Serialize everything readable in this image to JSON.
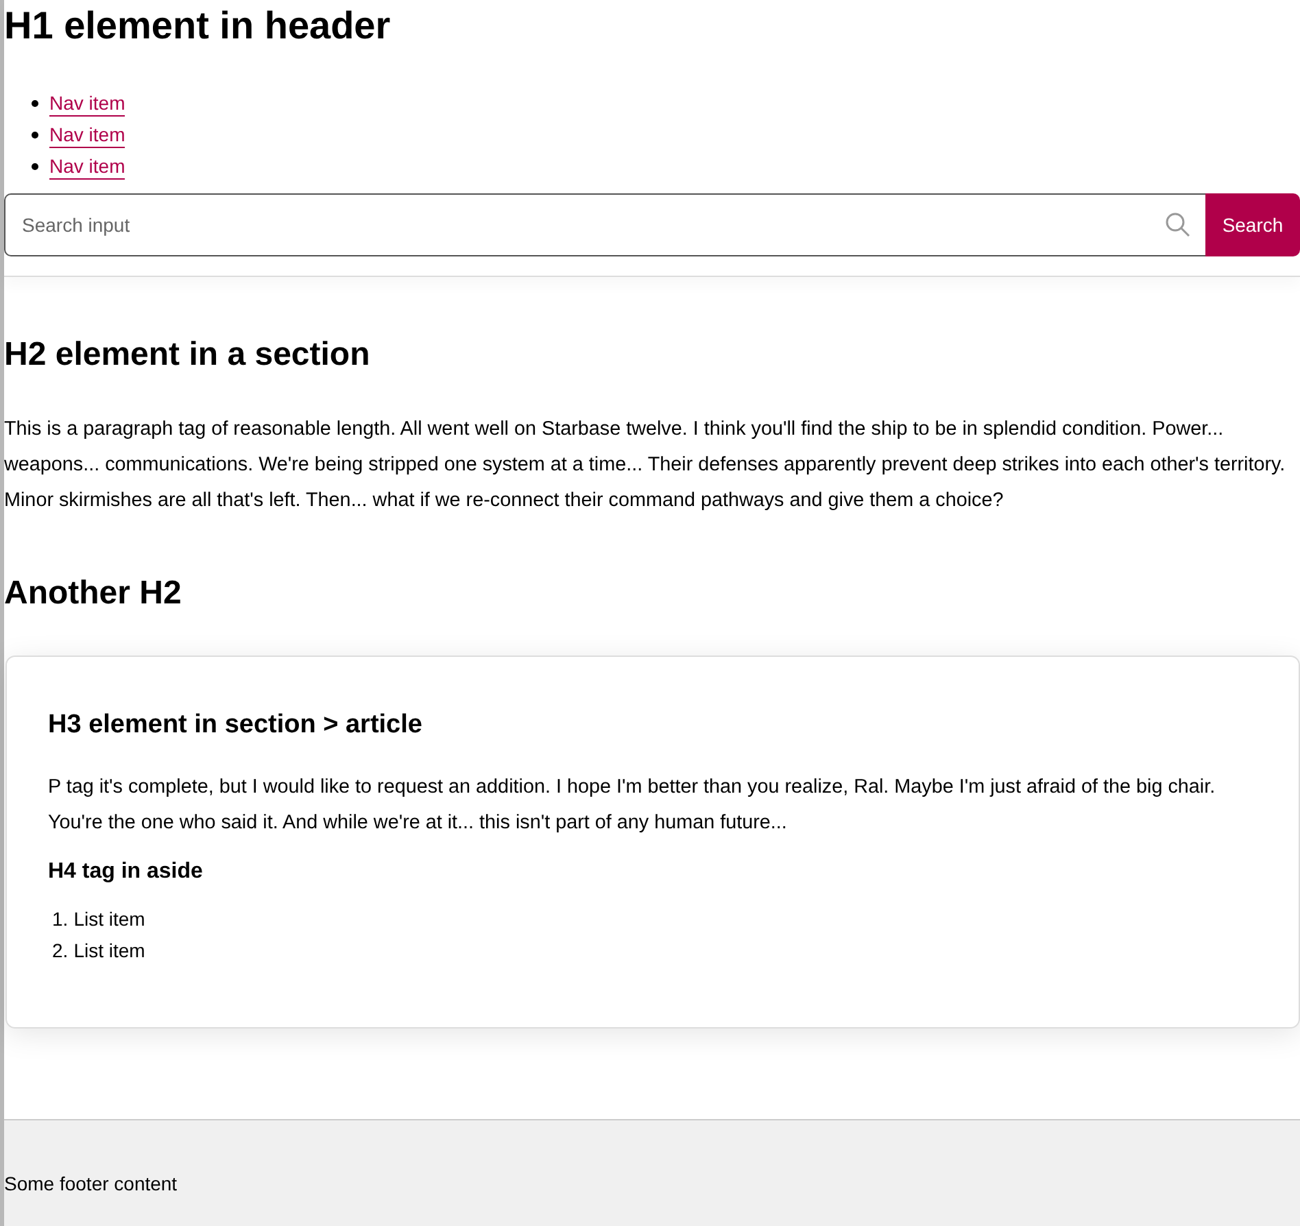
{
  "header": {
    "title": "H1 element in header",
    "nav": [
      {
        "label": "Nav item"
      },
      {
        "label": "Nav item"
      },
      {
        "label": "Nav item"
      }
    ],
    "search": {
      "placeholder": "Search input",
      "button": "Search"
    }
  },
  "section": {
    "title": "H2 element in a section",
    "paragraph": "This is a paragraph tag of reasonable length. All went well on Starbase twelve. I think you'll find the ship to be in splendid condition. Power... weapons... communications. We're being stripped one system at a time... Their defenses apparently prevent deep strikes into each other's territory. Minor skirmishes are all that's left. Then... what if we re-connect their command pathways and give them a choice?"
  },
  "section2": {
    "title": "Another H2",
    "article": {
      "title": "H3 element in section > article",
      "paragraph": "P tag it's complete, but I would like to request an addition. I hope I'm better than you realize, Ral. Maybe I'm just afraid of the big chair. You're the one who said it. And while we're at it... this isn't part of any human future...",
      "aside": {
        "title": "H4 tag in aside",
        "items": [
          {
            "marker": "1.",
            "label": "List item"
          },
          {
            "marker": "2.",
            "label": "List item"
          }
        ]
      }
    }
  },
  "footer": {
    "text": "Some footer content"
  }
}
